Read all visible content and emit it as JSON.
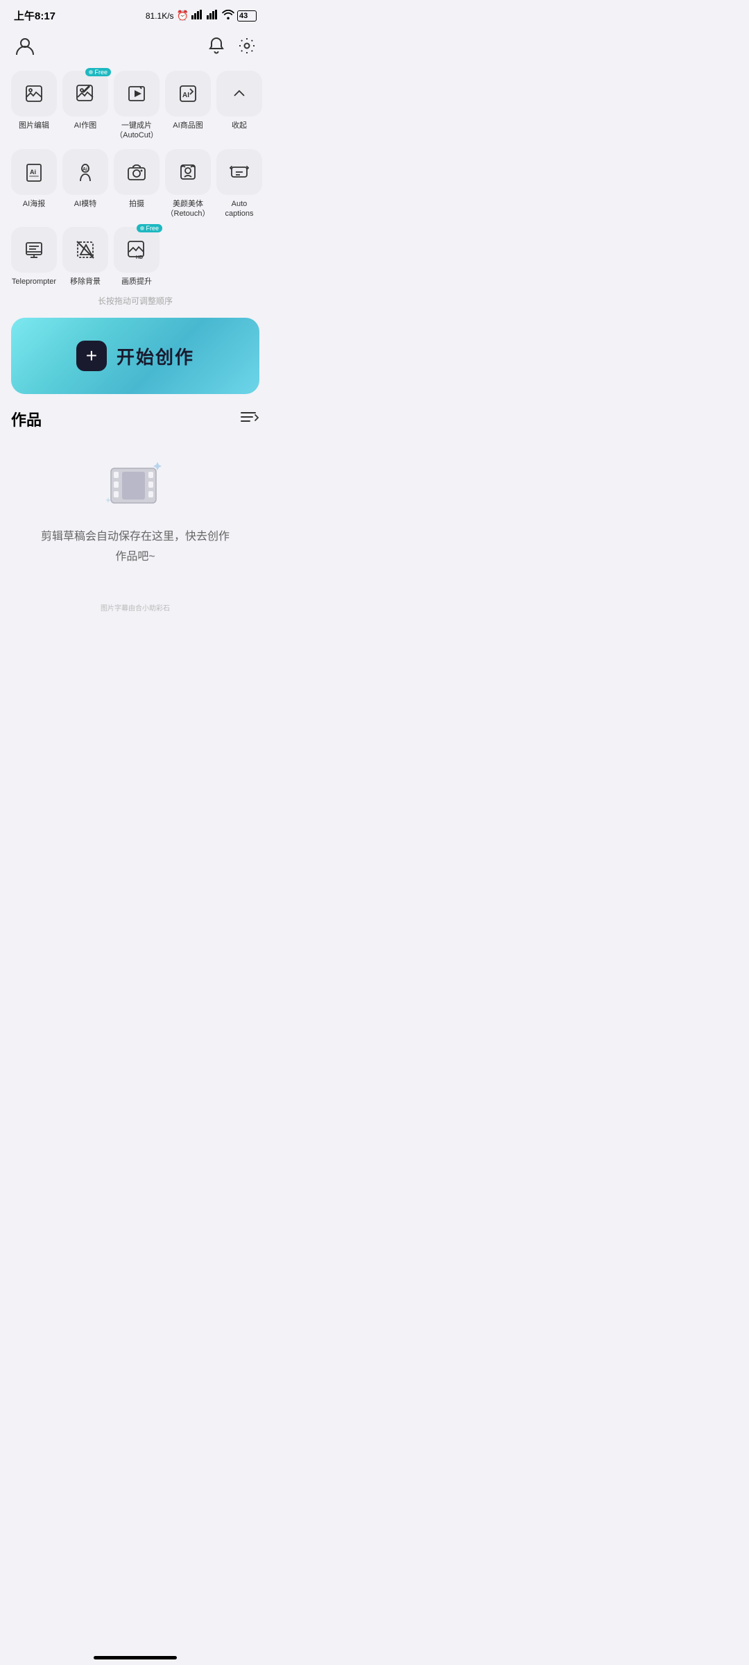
{
  "statusBar": {
    "time": "上午8:17",
    "network": "81.1K/s",
    "battery": "43"
  },
  "header": {
    "userIcon": "👤",
    "bellIcon": "🔔",
    "settingsIcon": "⚙"
  },
  "toolsRow1": [
    {
      "id": "image-edit",
      "label": "图片编辑",
      "hasFree": false
    },
    {
      "id": "ai-draw",
      "label": "AI作图",
      "hasFree": true
    },
    {
      "id": "autocut",
      "label": "一键成片\n（AutoCut）",
      "hasFree": false
    },
    {
      "id": "ai-product",
      "label": "AI商品图",
      "hasFree": false
    },
    {
      "id": "collapse",
      "label": "收起",
      "hasFree": false
    }
  ],
  "toolsRow2": [
    {
      "id": "ai-poster",
      "label": "AI海报",
      "hasFree": false
    },
    {
      "id": "ai-model",
      "label": "AI模特",
      "hasFree": false
    },
    {
      "id": "camera",
      "label": "拍摄",
      "hasFree": false
    },
    {
      "id": "retouch",
      "label": "美颜美体\n（Retouch）",
      "hasFree": false
    },
    {
      "id": "auto-captions",
      "label": "Auto captions",
      "hasFree": false
    }
  ],
  "toolsRow3": [
    {
      "id": "teleprompter",
      "label": "Teleprompter",
      "hasFree": false
    },
    {
      "id": "remove-bg",
      "label": "移除背景",
      "hasFree": false
    },
    {
      "id": "hd-enhance",
      "label": "画质提升",
      "hasFree": true
    }
  ],
  "dragHint": "长按拖动可调整顺序",
  "createBtn": {
    "plusLabel": "+",
    "text": "开始创作"
  },
  "works": {
    "title": "作品",
    "emptyHint": "剪辑草稿会自动保存在这里，快去创作\n作品吧~"
  },
  "watermark": "图片字幕由合小助彩石"
}
